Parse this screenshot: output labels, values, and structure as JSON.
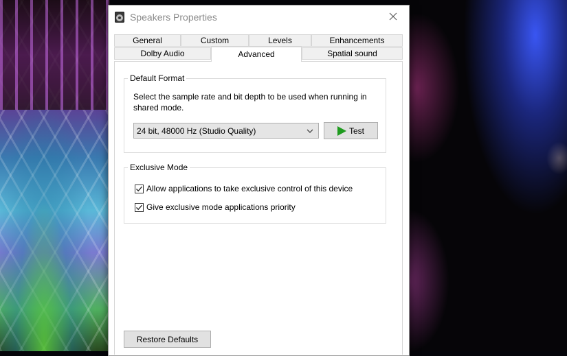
{
  "window": {
    "title": "Speakers Properties",
    "close_icon": "close-icon"
  },
  "tabs": {
    "row_back": [
      "General",
      "Custom",
      "Levels",
      "Enhancements"
    ],
    "row_front": [
      "Dolby Audio",
      "Advanced",
      "Spatial sound"
    ],
    "active": "Advanced"
  },
  "default_format": {
    "label": "Default Format",
    "description_line1": "Select the sample rate and bit depth to be used when running in",
    "description_line2": "shared mode.",
    "selected_format": "24 bit, 48000 Hz (Studio Quality)",
    "test_label": "Test"
  },
  "exclusive_mode": {
    "label": "Exclusive Mode",
    "allow_label": "Allow applications to take exclusive control of this device",
    "allow_checked": true,
    "priority_label": "Give exclusive mode applications priority",
    "priority_checked": true
  },
  "footer": {
    "restore_label": "Restore Defaults"
  },
  "colors": {
    "accent_play": "#1f9b1f"
  }
}
